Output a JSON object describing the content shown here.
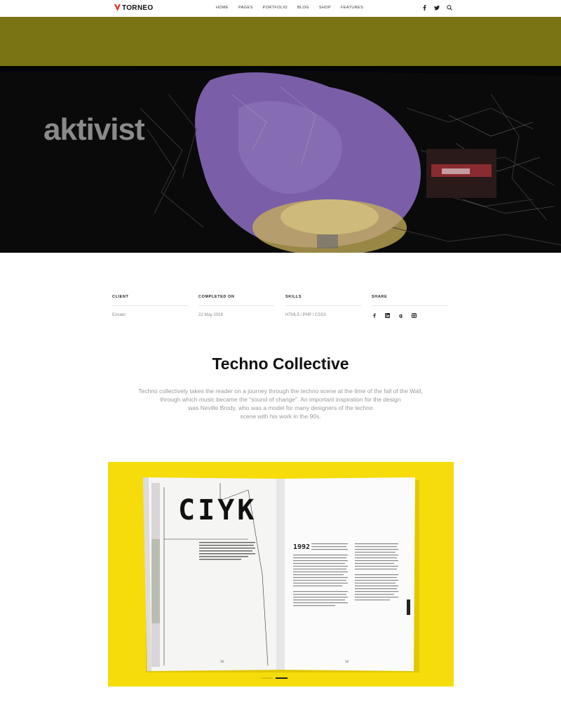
{
  "header": {
    "logo_text": "TORNEO",
    "nav": [
      "HOME",
      "PAGES",
      "PORTFOLIO",
      "BLOG",
      "SHOP",
      "FEATURES"
    ],
    "icons": [
      "facebook-icon",
      "twitter-icon",
      "search-icon"
    ]
  },
  "hero": {
    "text": "aktivist",
    "colors": {
      "top_band": "#7a7415",
      "purple": "#7a5fa8",
      "dark": "#050505"
    }
  },
  "meta": {
    "client_label": "CLIENT",
    "client_value": "Envato",
    "completed_label": "COMPLETED ON",
    "completed_value": "22 May 2018",
    "skills_label": "SKILLS",
    "skills_value": "HTML5 / PHP / CSS3",
    "share_label": "SHARE",
    "share_icons": [
      "facebook-icon",
      "linkedin-icon",
      "google-plus-icon",
      "instagram-icon"
    ]
  },
  "project": {
    "title": "Techno Collective",
    "description_lines": [
      "Techno collectively takes the reader on a journey through the techno scene at the time of the fall of the Wall,",
      "through which music became the \"sound of change\". An important inspiration for the design",
      "was Neville Brody, who was a model for many designers of the techno",
      "scene with his work in the 90s."
    ]
  },
  "gallery": {
    "magazine_word": "CIYK",
    "page_number_left": "16",
    "page_number_right": "16",
    "year": "1992",
    "background": "#f6dc0a",
    "slides": 2,
    "active_slide": 2
  }
}
